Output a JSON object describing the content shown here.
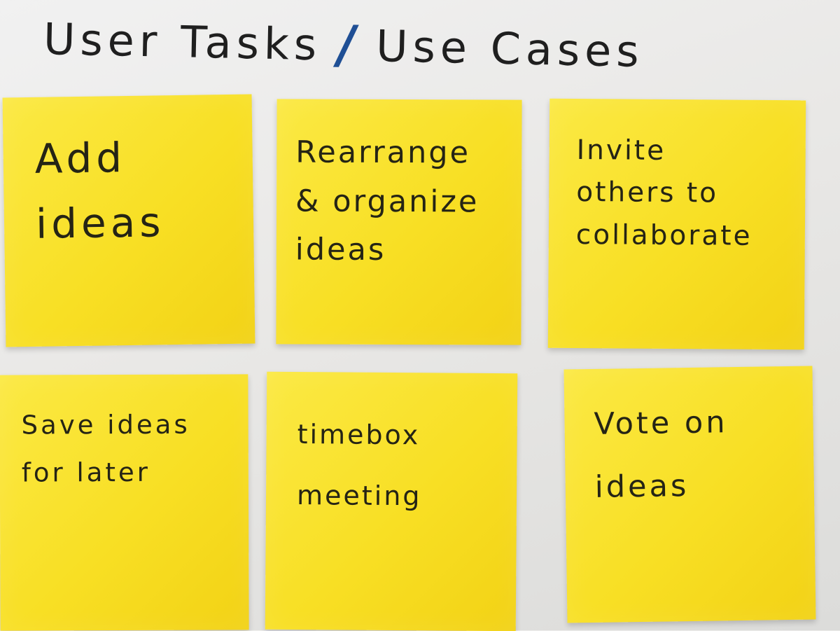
{
  "board": {
    "title": {
      "left": "User Tasks",
      "separator": "/",
      "right": "Use Cases"
    }
  },
  "notes": [
    {
      "text": "Add\nideas"
    },
    {
      "text": "Rearrange\n& organize\nideas"
    },
    {
      "text": "Invite\nothers to\ncollaborate"
    },
    {
      "text": "Save ideas\nfor later"
    },
    {
      "text": "timebox\nmeeting"
    },
    {
      "text": "Vote on\nideas"
    }
  ],
  "colors": {
    "note": "#f8df24",
    "ink": "#252415",
    "accent": "#1f4f95",
    "background": "#ececea"
  }
}
